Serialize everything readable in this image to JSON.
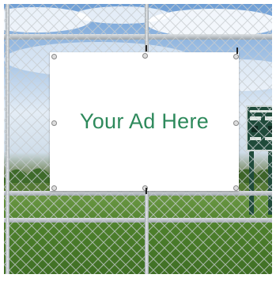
{
  "banner": {
    "text": "Your Ad Here",
    "text_color": "#2e8a5c",
    "background": "#ffffff"
  },
  "icons": {
    "fence": "chain-link-fence-icon",
    "scoreboard": "scoreboard-icon"
  }
}
